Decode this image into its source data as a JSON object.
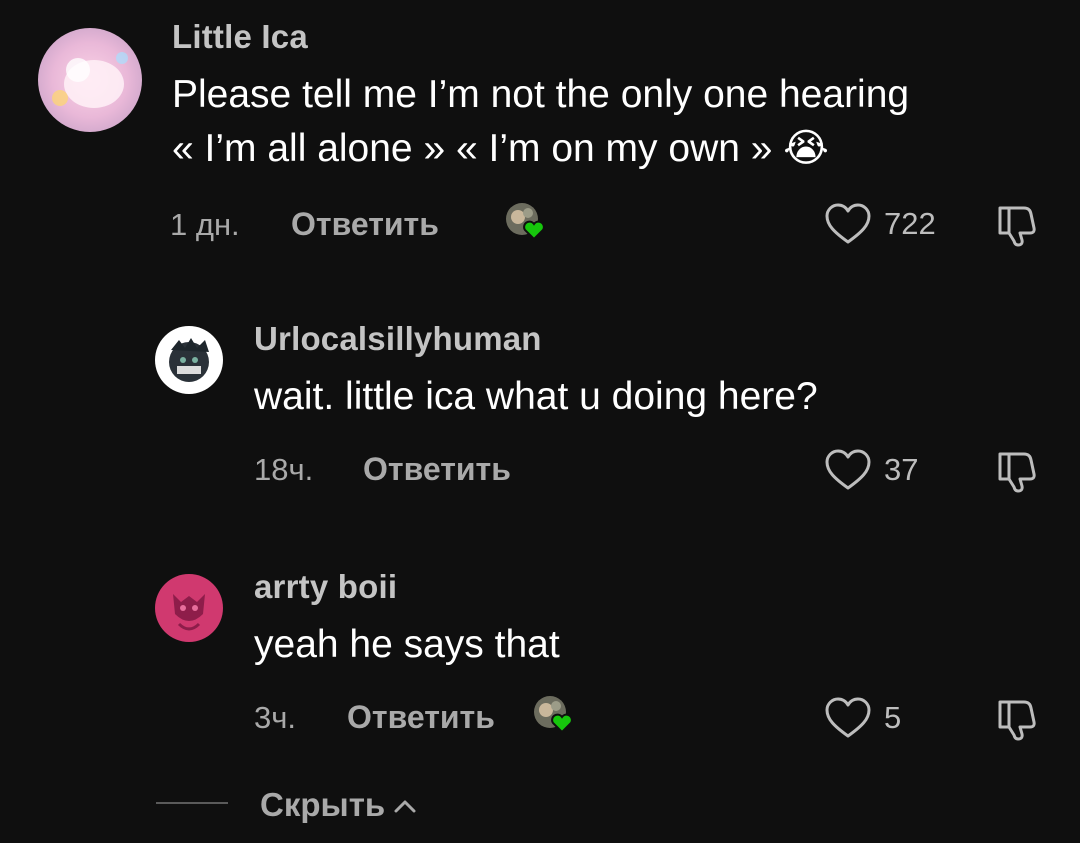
{
  "comments": [
    {
      "username": "Little Ica",
      "text_line1": "Please tell me I’m not the only one hearing",
      "text_line2": "« I’m all alone » « I’m on my own » 😭",
      "time": "1 дн.",
      "reply_label": "Ответить",
      "likes": "722",
      "creator_liked": true
    },
    {
      "username": "Urlocalsillyhuman",
      "text_line1": "wait. little ica what u doing here?",
      "time": "18ч.",
      "reply_label": "Ответить",
      "likes": "37",
      "creator_liked": false
    },
    {
      "username": "arrty boii",
      "text_line1": "yeah he says that",
      "time": "3ч.",
      "reply_label": "Ответить",
      "likes": "5",
      "creator_liked": true
    }
  ],
  "hide_replies_label": "Скрыть",
  "icons": {
    "like": "heart-outline-icon",
    "dislike": "thumbs-down-icon",
    "creator_like_badge": "green-heart-icon",
    "hide_chevron": "chevron-up-icon"
  },
  "colors": {
    "background": "#0f0f0f",
    "secondary_text": "#a9a9a9",
    "creator_heart": "#16c60c"
  }
}
